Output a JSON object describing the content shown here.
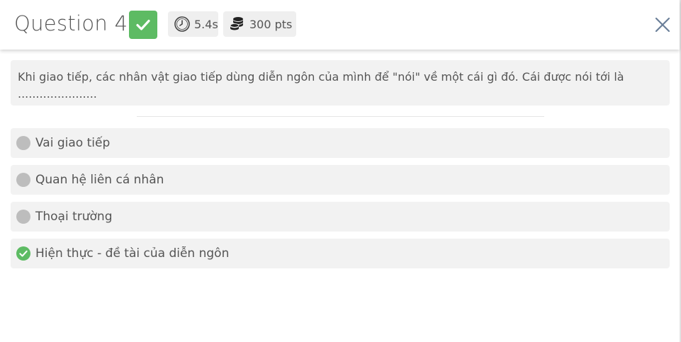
{
  "header": {
    "title": "Question 4",
    "correct_icon": "check-icon",
    "time": "5.4s",
    "time_icon": "clock-icon",
    "points": "300 pts",
    "points_icon": "coins-icon",
    "close_icon": "close-icon"
  },
  "question": {
    "text": "Khi giao tiếp, các nhân vật giao tiếp dùng diễn ngôn của mình để \"nói\" về một cái gì đó. Cái được nói tới là ......................"
  },
  "options": [
    {
      "label": "Vai giao tiếp",
      "state": "unselected"
    },
    {
      "label": "Quan hệ liên cá nhân",
      "state": "unselected"
    },
    {
      "label": "Thoại trường",
      "state": "unselected"
    },
    {
      "label": "Hiện thực - đề tài của diễn ngôn",
      "state": "correct"
    }
  ],
  "colors": {
    "correct": "#5dbb63",
    "neutral_radio": "#bdbdbd",
    "box_bg": "#f2f2f2"
  }
}
